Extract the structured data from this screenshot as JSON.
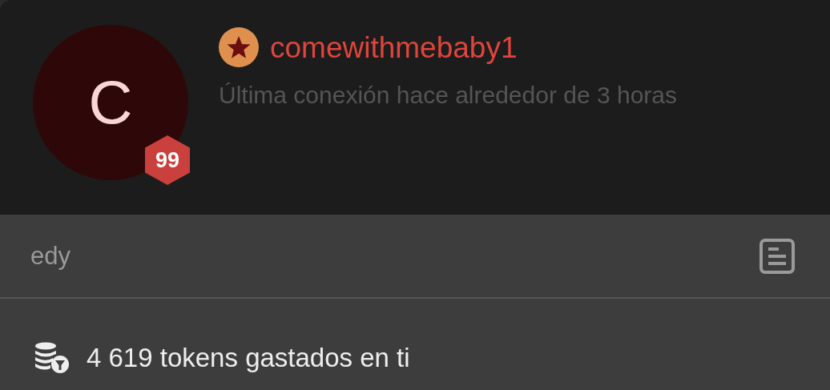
{
  "profile": {
    "avatar_initial": "C",
    "level_badge": "99",
    "username": "comewithmebaby1",
    "last_seen": "Última conexión hace alrededor de 3 horas"
  },
  "note": {
    "text": "edy"
  },
  "tokens": {
    "text": "4 619 tokens gastados en ti"
  }
}
